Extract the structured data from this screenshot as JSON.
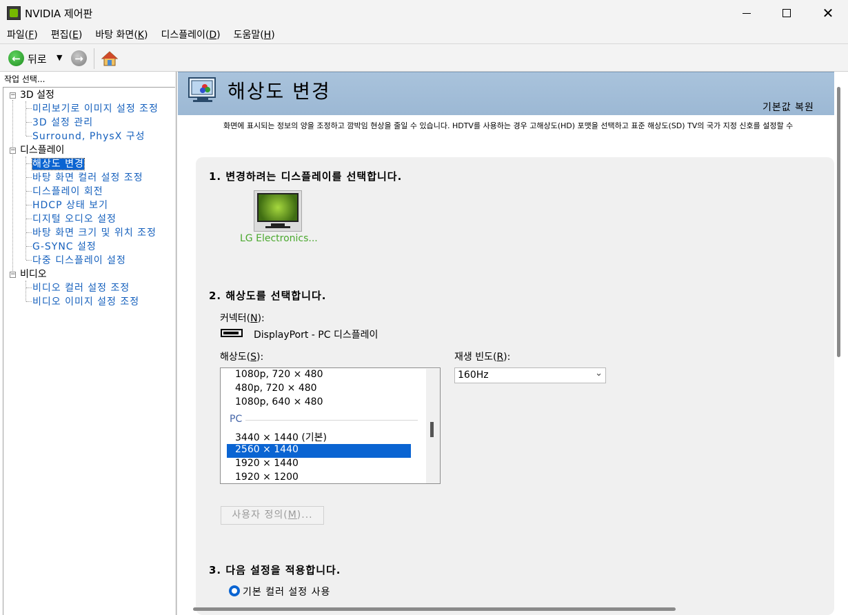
{
  "window": {
    "title": "NVIDIA 제어판"
  },
  "menu": [
    {
      "label": "파일",
      "key": "(F)",
      "u": "F"
    },
    {
      "label": "편집",
      "key": "(E)",
      "u": "E"
    },
    {
      "label": "바탕 화면",
      "key": "(K)",
      "u": "K"
    },
    {
      "label": "디스플레이",
      "key": "(D)",
      "u": "D"
    },
    {
      "label": "도움말",
      "key": "(H)",
      "u": "H"
    }
  ],
  "toolbar": {
    "back_label": "뒤로"
  },
  "sidebar": {
    "header": "작업 선택...",
    "categories": [
      {
        "label": "3D 설정",
        "items": [
          "미리보기로 이미지 설정 조정",
          "3D 설정 관리",
          "Surround, PhysX 구성"
        ]
      },
      {
        "label": "디스플레이",
        "items": [
          "해상도 변경",
          "바탕 화면 컬러 설정 조정",
          "디스플레이 회전",
          "HDCP 상태 보기",
          "디지털 오디오 설정",
          "바탕 화면 크기 및 위치 조정",
          "G-SYNC 설정",
          "다중 디스플레이 설정"
        ]
      },
      {
        "label": "비디오",
        "items": [
          "비디오 컬러 설정 조정",
          "비디오 이미지 설정 조정"
        ]
      }
    ],
    "selected_item": "해상도 변경"
  },
  "page": {
    "title": "해상도 변경",
    "restore_label": "기본값 복원",
    "description": "화면에 표시되는 정보의 양을 조정하고 깜박임 현상을 줄일 수 있습니다. HDTV를 사용하는 경우 고해상도(HD) 포맷을 선택하고 표준 해상도(SD) TV의 국가 지정 신호를 설정할 수"
  },
  "step1": {
    "heading": "1. 변경하려는 디스플레이를 선택합니다.",
    "display_name": "LG Electronics..."
  },
  "step2": {
    "heading": "2. 해상도를 선택합니다.",
    "connector_label": "커넥터(N):",
    "connector_value": "DisplayPort - PC 디스플레이",
    "resolution_label": "해상도(S):",
    "refresh_label": "재생 빈도(R):",
    "refresh_value": "160Hz",
    "resolutions_above": [
      "1080p, 720 × 480",
      "480p, 720 × 480",
      "1080p, 640 × 480"
    ],
    "group_label": "PC",
    "resolutions_pc": [
      "3440 × 1440 (기본)",
      "2560 × 1440",
      "1920 × 1440",
      "1920 × 1200"
    ],
    "selected_resolution": "2560 × 1440",
    "custom_button": "사용자 정의(M)..."
  },
  "step3": {
    "heading": "3. 다음 설정을 적용합니다.",
    "radio_default": "기본 컬러 설정 사용"
  },
  "colors": {
    "accent": "#0a64d2",
    "nvidia_green": "#76b900",
    "link_blue": "#1560bd",
    "banner": "#a9c3dc"
  }
}
